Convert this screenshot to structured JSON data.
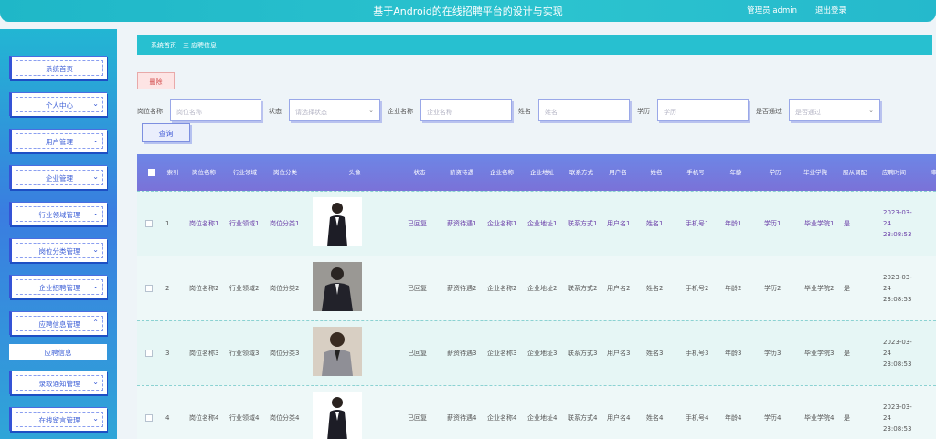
{
  "header": {
    "title": "基于Android的在线招聘平台的设计与实现",
    "user_label": "管理员 admin",
    "logout": "退出登录"
  },
  "sidebar": {
    "items": [
      {
        "label": "系统首页"
      },
      {
        "label": "个人中心",
        "chevron": "⌄"
      },
      {
        "label": "用户管理",
        "chevron": "⌄"
      },
      {
        "label": "企业管理",
        "chevron": "⌄"
      },
      {
        "label": "行业领域管理",
        "chevron": "⌄"
      },
      {
        "label": "岗位分类管理",
        "chevron": "⌄"
      },
      {
        "label": "企业招聘管理",
        "chevron": "⌄"
      },
      {
        "label": "应聘信息管理",
        "chevron": "⌃"
      },
      {
        "label": "录取通知管理",
        "chevron": "⌄"
      },
      {
        "label": "在线留言管理",
        "chevron": "⌄"
      }
    ],
    "submenu": "应聘信息"
  },
  "breadcrumb": {
    "home": "系统首页",
    "sep": "三",
    "current": "应聘信息"
  },
  "toolbar": {
    "delete_label": "删除",
    "query_label": "查询"
  },
  "search": {
    "job_label": "岗位名称",
    "job_placeholder": "岗位名称",
    "status_label": "状态",
    "status_placeholder": "请选择状态",
    "company_label": "企业名称",
    "company_placeholder": "企业名称",
    "name_label": "姓名",
    "name_placeholder": "姓名",
    "edu_label": "学历",
    "edu_placeholder": "学历",
    "pass_label": "是否通过",
    "pass_placeholder": "是否通过"
  },
  "table": {
    "headers": [
      "索引",
      "岗位名称",
      "行业领域",
      "岗位分类",
      "头像",
      "状态",
      "薪资待遇",
      "企业名称",
      "企业地址",
      "联系方式",
      "用户名",
      "姓名",
      "手机号",
      "年龄",
      "学历",
      "毕业学院",
      "服从调配",
      "应聘时间",
      "审"
    ],
    "rows": [
      {
        "idx": "1",
        "job": "岗位名称1",
        "field": "行业领域1",
        "cat": "岗位分类1",
        "status": "已回复",
        "salary": "薪资待遇1",
        "company": "企业名称1",
        "addr": "企业地址1",
        "contact": "联系方式1",
        "user": "用户名1",
        "name": "姓名1",
        "phone": "手机号1",
        "age": "年龄1",
        "edu": "学历1",
        "school": "毕业学院1",
        "obey": "是",
        "time": "2023-03-24 23:08:53"
      },
      {
        "idx": "2",
        "job": "岗位名称2",
        "field": "行业领域2",
        "cat": "岗位分类2",
        "status": "已回复",
        "salary": "薪资待遇2",
        "company": "企业名称2",
        "addr": "企业地址2",
        "contact": "联系方式2",
        "user": "用户名2",
        "name": "姓名2",
        "phone": "手机号2",
        "age": "年龄2",
        "edu": "学历2",
        "school": "毕业学院2",
        "obey": "是",
        "time": "2023-03-24 23:08:53"
      },
      {
        "idx": "3",
        "job": "岗位名称3",
        "field": "行业领域3",
        "cat": "岗位分类3",
        "status": "已回复",
        "salary": "薪资待遇3",
        "company": "企业名称3",
        "addr": "企业地址3",
        "contact": "联系方式3",
        "user": "用户名3",
        "name": "姓名3",
        "phone": "手机号3",
        "age": "年龄3",
        "edu": "学历3",
        "school": "毕业学院3",
        "obey": "是",
        "time": "2023-03-24 23:08:53"
      },
      {
        "idx": "4",
        "job": "岗位名称4",
        "field": "行业领域4",
        "cat": "岗位分类4",
        "status": "已回复",
        "salary": "薪资待遇4",
        "company": "企业名称4",
        "addr": "企业地址4",
        "contact": "联系方式4",
        "user": "用户名4",
        "name": "姓名4",
        "phone": "手机号4",
        "age": "年龄4",
        "edu": "学历4",
        "school": "毕业学院4",
        "obey": "是",
        "time": "2023-03-24 23:08:53"
      }
    ]
  },
  "colors": {
    "accent": "#27c0d0",
    "header_bg": "#6d86e6",
    "link": "#6a3ea8"
  }
}
